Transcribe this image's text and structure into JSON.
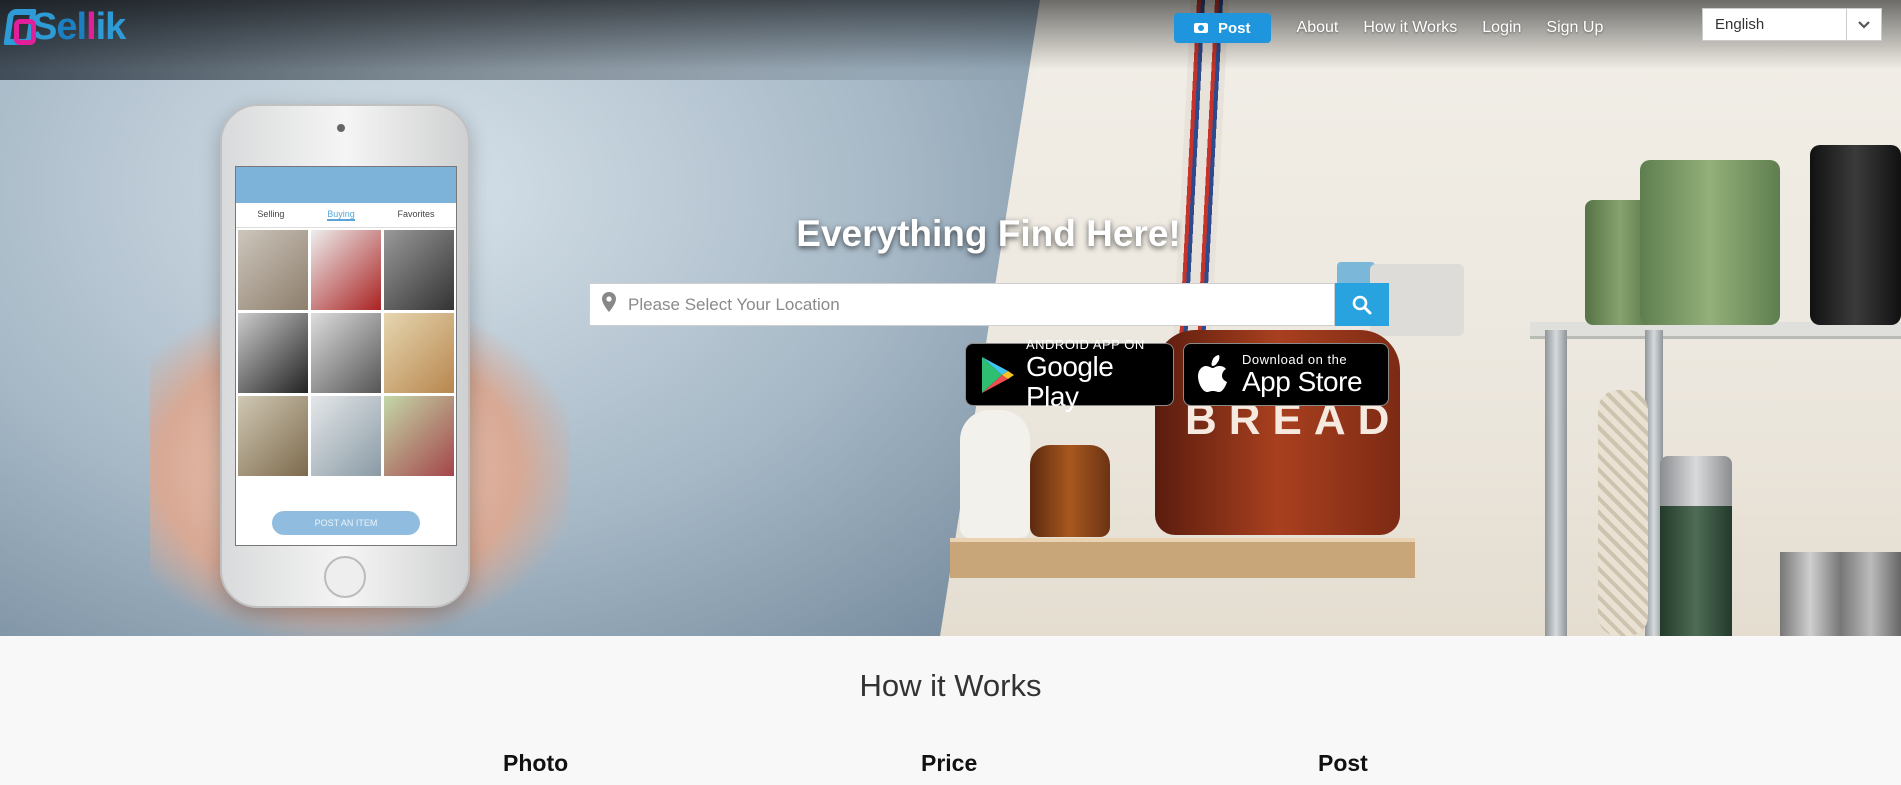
{
  "brand": {
    "logo_text_s": "S",
    "logo_text_el": "el",
    "logo_text_l": "l",
    "logo_text_ik": "ik"
  },
  "nav": {
    "post_label": "Post",
    "about": "About",
    "how_it_works": "How it Works",
    "login": "Login",
    "signup": "Sign Up",
    "language": {
      "selected": "English"
    }
  },
  "hero": {
    "headline": "Everything Find Here!",
    "search": {
      "placeholder": "Please Select Your Location"
    },
    "google_play": {
      "small": "ANDROID APP ON",
      "big": "Google Play"
    },
    "app_store": {
      "small": "Download on the",
      "big": "App Store"
    },
    "phone_screen": {
      "tabs": [
        "Selling",
        "Buying",
        "Favorites"
      ],
      "post_button": "POST AN ITEM"
    },
    "jar_text": "BREAD"
  },
  "how": {
    "title": "How it Works",
    "steps": [
      "Photo",
      "Price",
      "Post"
    ]
  },
  "colors": {
    "accent": "#1e95dc",
    "search_button": "#29a3e0",
    "brand_blue": "#2e9bd6",
    "brand_pink": "#e0209b"
  },
  "icons": {
    "post": "camera-icon",
    "location": "map-pin-icon",
    "search": "search-icon",
    "language": "chevron-down-icon",
    "google_play": "play-icon",
    "app_store": "apple-icon"
  }
}
